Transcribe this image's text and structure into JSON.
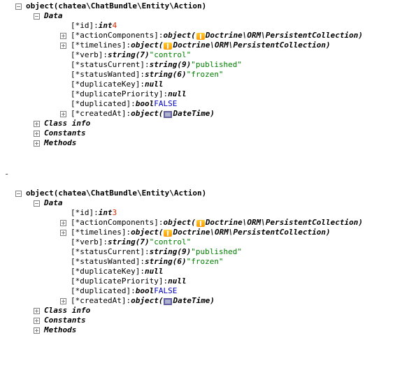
{
  "objects": [
    {
      "header": "object(chatea\\ChatBundle\\Entity\\Action)",
      "data_label": "Data",
      "class_info": "Class info",
      "constants": "Constants",
      "methods": "Methods",
      "props": {
        "id": {
          "key": "[*id]: ",
          "type": "int ",
          "value": "4"
        },
        "ac": {
          "key": "[*actionComponents]: ",
          "type": "object( ",
          "class": "Doctrine\\ORM\\PersistentCollection)"
        },
        "tl": {
          "key": "[*timelines]: ",
          "type": "object( ",
          "class": "Doctrine\\ORM\\PersistentCollection)"
        },
        "verb": {
          "key": "[*verb]: ",
          "type": "string(7) ",
          "value": "\"control\""
        },
        "scur": {
          "key": "[*statusCurrent]: ",
          "type": "string(9) ",
          "value": "\"published\""
        },
        "swant": {
          "key": "[*statusWanted]: ",
          "type": "string(6) ",
          "value": "\"frozen\""
        },
        "dkey": {
          "key": "[*duplicateKey]: ",
          "type": "null"
        },
        "dprio": {
          "key": "[*duplicatePriority]: ",
          "type": "null"
        },
        "dup": {
          "key": "[*duplicated]: ",
          "type": "bool ",
          "value": "FALSE"
        },
        "created": {
          "key": "[*createdAt]: ",
          "type": "object( ",
          "class": "DateTime)"
        }
      }
    },
    {
      "header": "object(chatea\\ChatBundle\\Entity\\Action)",
      "data_label": "Data",
      "class_info": "Class info",
      "constants": "Constants",
      "methods": "Methods",
      "props": {
        "id": {
          "key": "[*id]: ",
          "type": "int ",
          "value": "3"
        },
        "ac": {
          "key": "[*actionComponents]: ",
          "type": "object( ",
          "class": "Doctrine\\ORM\\PersistentCollection)"
        },
        "tl": {
          "key": "[*timelines]: ",
          "type": "object( ",
          "class": "Doctrine\\ORM\\PersistentCollection)"
        },
        "verb": {
          "key": "[*verb]: ",
          "type": "string(7) ",
          "value": "\"control\""
        },
        "scur": {
          "key": "[*statusCurrent]: ",
          "type": "string(9) ",
          "value": "\"published\""
        },
        "swant": {
          "key": "[*statusWanted]: ",
          "type": "string(6) ",
          "value": "\"frozen\""
        },
        "dkey": {
          "key": "[*duplicateKey]: ",
          "type": "null"
        },
        "dprio": {
          "key": "[*duplicatePriority]: ",
          "type": "null"
        },
        "dup": {
          "key": "[*duplicated]: ",
          "type": "bool ",
          "value": "FALSE"
        },
        "created": {
          "key": "[*createdAt]: ",
          "type": "object( ",
          "class": "DateTime)"
        }
      }
    }
  ]
}
